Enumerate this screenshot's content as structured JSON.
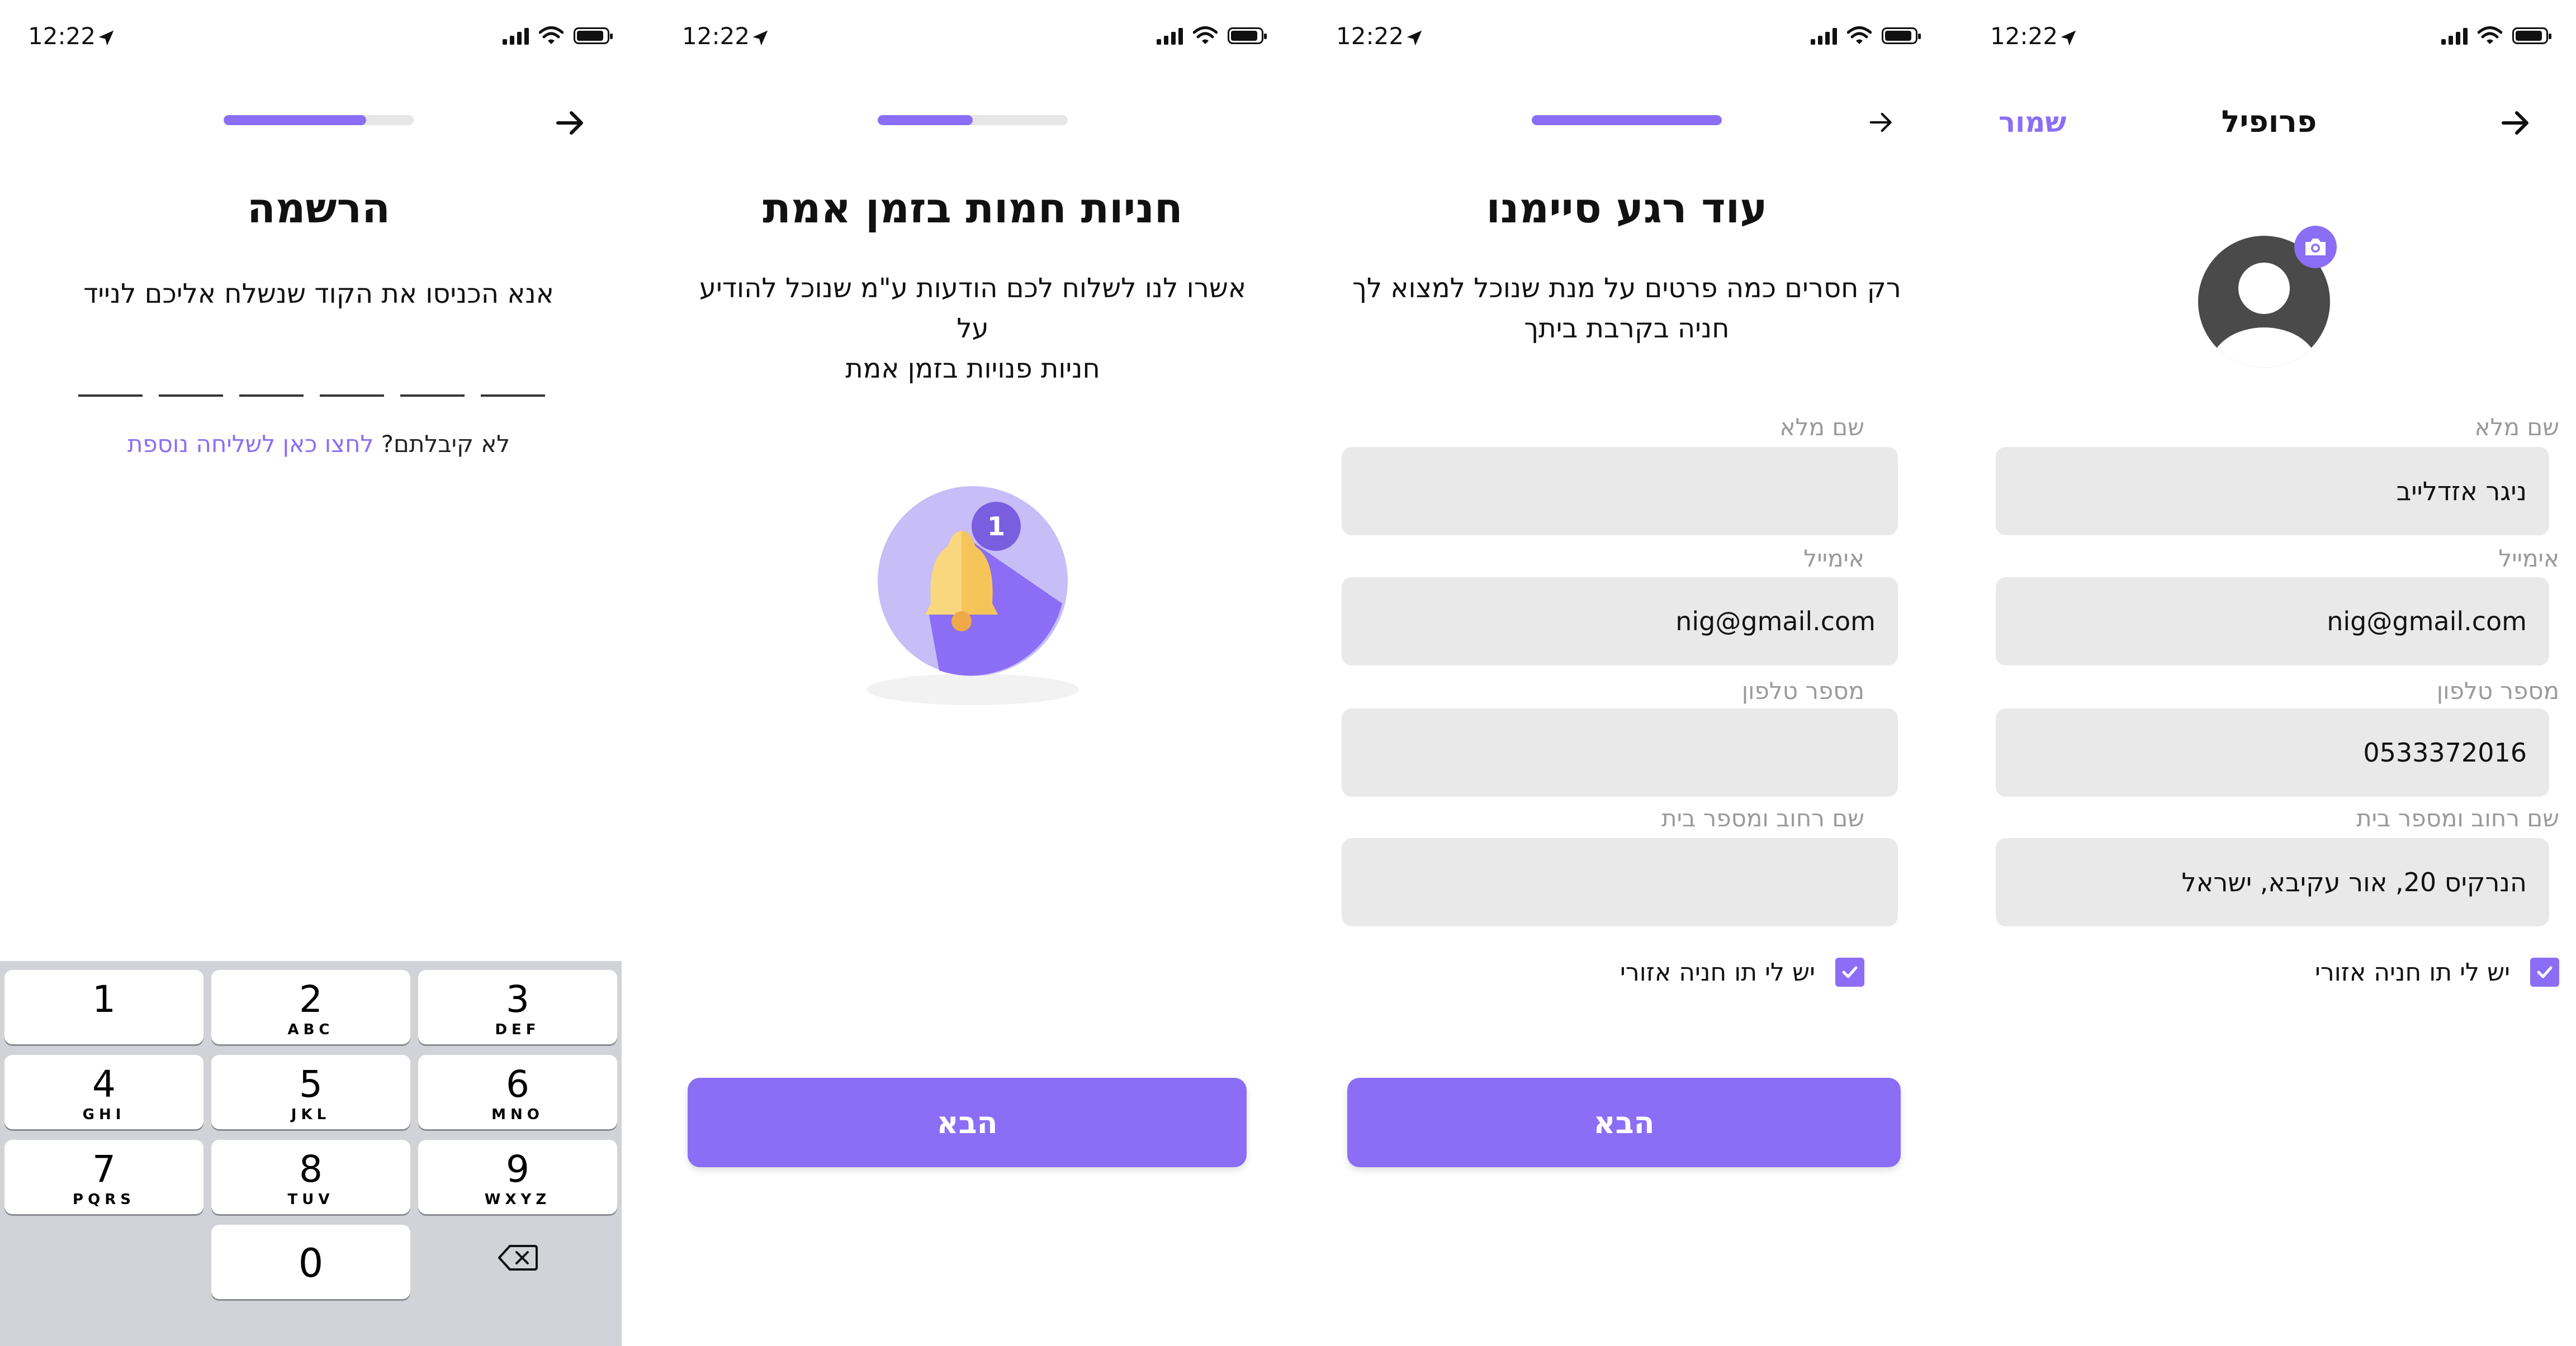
{
  "status_bar": {
    "time": "12:22"
  },
  "colors": {
    "accent": "#8b6ef5",
    "field_bg": "#e9e9e9",
    "label_gray": "#9a9a9a"
  },
  "screens": {
    "verify": {
      "progress": 0.75,
      "title": "הרשמה",
      "subtitle": "אנא הכניסו את הקוד שנשלח אליכם לנייד",
      "otp_length": 6,
      "resend_prefix": "לא קיבלתם? ",
      "resend_link": "לחצו כאן לשליחה נוספת",
      "keypad": [
        {
          "digit": "1",
          "letters": ""
        },
        {
          "digit": "2",
          "letters": "ABC"
        },
        {
          "digit": "3",
          "letters": "DEF"
        },
        {
          "digit": "4",
          "letters": "GHI"
        },
        {
          "digit": "5",
          "letters": "JKL"
        },
        {
          "digit": "6",
          "letters": "MNO"
        },
        {
          "digit": "7",
          "letters": "PQRS"
        },
        {
          "digit": "8",
          "letters": "TUV"
        },
        {
          "digit": "9",
          "letters": "WXYZ"
        },
        {
          "digit": "0",
          "letters": ""
        }
      ],
      "delete_icon": "backspace-icon"
    },
    "notifications": {
      "progress": 0.5,
      "title": "חניות חמות בזמן אמת",
      "subtitle_line1": "אשרו לנו לשלוח לכם הודעות ע\"מ שנוכל להודיע על",
      "subtitle_line2": "חניות פנויות בזמן אמת",
      "badge_count": "1",
      "illustration_icon": "bell-icon",
      "next_label": "הבא"
    },
    "details": {
      "progress": 1.0,
      "title": "עוד רגע סיימנו",
      "subtitle_line1": "רק חסרים כמה פרטים על מנת שנוכל למצוא לך",
      "subtitle_line2": "חניה בקרבת ביתך",
      "fields": [
        {
          "label": "שם מלא",
          "value": ""
        },
        {
          "label": "אימייל",
          "value": "nig@gmail.com"
        },
        {
          "label": "מספר טלפון",
          "value": ""
        },
        {
          "label": "שם רחוב ומספר בית",
          "value": ""
        }
      ],
      "checkbox_label": "יש לי תו חניה אזורי",
      "checkbox_checked": true,
      "next_label": "הבא"
    },
    "profile": {
      "title": "פרופיל",
      "save_label": "שמור",
      "avatar_icon": "user-avatar-icon",
      "camera_icon": "camera-icon",
      "fields": [
        {
          "label": "שם מלא",
          "value": "ניגר אזדלייב"
        },
        {
          "label": "אימייל",
          "value": "nig@gmail.com"
        },
        {
          "label": "מספר טלפון",
          "value": "0533372016"
        },
        {
          "label": "שם רחוב ומספר בית",
          "value": "הנרקיס 20, אור עקיבא, ישראל"
        }
      ],
      "checkbox_label": "יש לי תו חניה אזורי",
      "checkbox_checked": true
    }
  }
}
